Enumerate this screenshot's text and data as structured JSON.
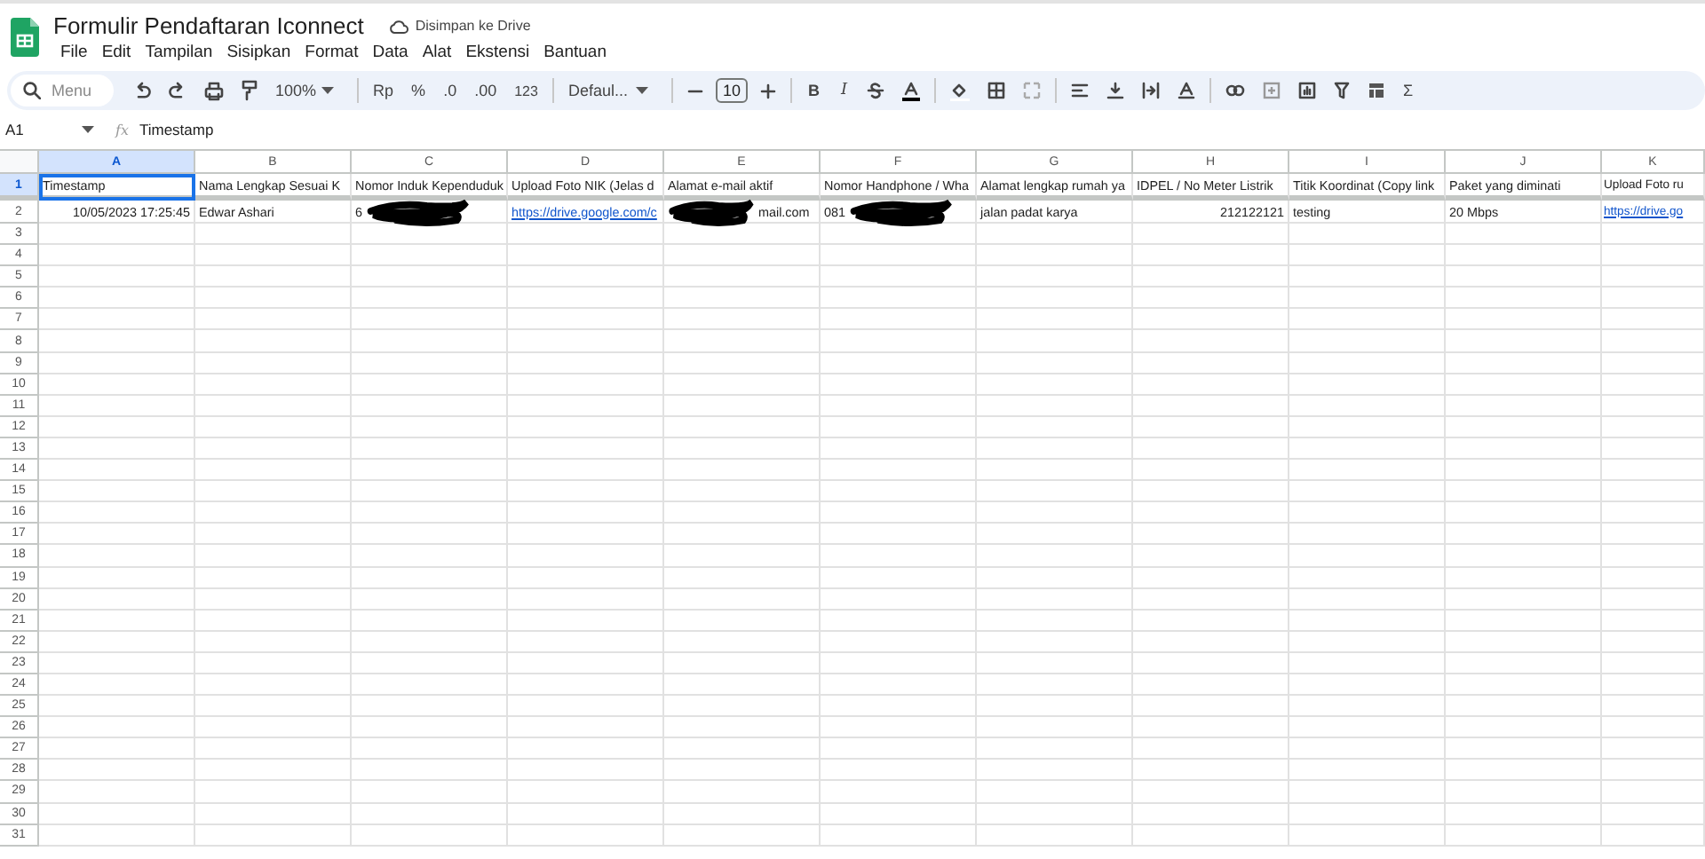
{
  "document": {
    "title": "Formulir Pendaftaran Iconnect",
    "save_status": "Disimpan ke Drive"
  },
  "menu": [
    "File",
    "Edit",
    "Tampilan",
    "Sisipkan",
    "Format",
    "Data",
    "Alat",
    "Ekstensi",
    "Bantuan"
  ],
  "toolbar": {
    "search_placeholder": "Menu",
    "zoom": "100%",
    "currency": "Rp",
    "percent": "%",
    "decrease_decimal": ".0",
    "increase_decimal": ".00",
    "number_format": "123",
    "font": "Defaul...",
    "font_size": "10",
    "bold": "B",
    "italic": "I",
    "functions": "Σ"
  },
  "formula_bar": {
    "name_box": "A1",
    "fx": "fx",
    "value": "Timestamp"
  },
  "columns": [
    {
      "label": "A",
      "selected": true
    },
    {
      "label": "B",
      "selected": false
    },
    {
      "label": "C",
      "selected": false
    },
    {
      "label": "D",
      "selected": false
    },
    {
      "label": "E",
      "selected": false
    },
    {
      "label": "F",
      "selected": false
    },
    {
      "label": "G",
      "selected": false
    },
    {
      "label": "H",
      "selected": false
    },
    {
      "label": "I",
      "selected": false
    },
    {
      "label": "J",
      "selected": false
    },
    {
      "label": "K",
      "selected": false
    }
  ],
  "rows": [
    {
      "number": "1",
      "selected": true,
      "cells": [
        {
          "kind": "text",
          "text": "Timestamp"
        },
        {
          "kind": "text",
          "text": "Nama Lengkap Sesuai K"
        },
        {
          "kind": "text",
          "text": "Nomor Induk Kependuduk"
        },
        {
          "kind": "text",
          "text": "Upload Foto NIK (Jelas d"
        },
        {
          "kind": "text",
          "text": "Alamat e-mail aktif"
        },
        {
          "kind": "text",
          "text": "Nomor Handphone / Wha"
        },
        {
          "kind": "text",
          "text": "Alamat lengkap rumah ya"
        },
        {
          "kind": "text",
          "text": "IDPEL / No Meter Listrik"
        },
        {
          "kind": "text",
          "text": "Titik Koordinat (Copy link"
        },
        {
          "kind": "text",
          "text": "Paket yang diminati"
        },
        {
          "kind": "text",
          "text": "Upload Foto ru"
        }
      ]
    },
    {
      "number": "2",
      "selected": false,
      "cells": [
        {
          "kind": "number",
          "text": "10/05/2023 17:25:45"
        },
        {
          "kind": "text",
          "text": "Edwar Ashari"
        },
        {
          "kind": "text",
          "text": "6",
          "redacted_after": true
        },
        {
          "kind": "link",
          "text": "https://drive.google.com/c"
        },
        {
          "kind": "text",
          "text": "mail.com",
          "redacted_before": true
        },
        {
          "kind": "text",
          "text": "081",
          "redacted_after": true
        },
        {
          "kind": "text",
          "text": "jalan padat karya"
        },
        {
          "kind": "number",
          "text": "212122121"
        },
        {
          "kind": "text",
          "text": "testing"
        },
        {
          "kind": "text",
          "text": "20 Mbps"
        },
        {
          "kind": "link",
          "text": "https://drive.go"
        }
      ]
    },
    {
      "number": "3",
      "selected": false
    },
    {
      "number": "4",
      "selected": false
    },
    {
      "number": "5",
      "selected": false
    },
    {
      "number": "6",
      "selected": false
    },
    {
      "number": "7",
      "selected": false
    },
    {
      "number": "8",
      "selected": false
    },
    {
      "number": "9",
      "selected": false
    },
    {
      "number": "10",
      "selected": false
    },
    {
      "number": "11",
      "selected": false
    },
    {
      "number": "12",
      "selected": false
    },
    {
      "number": "13",
      "selected": false
    },
    {
      "number": "14",
      "selected": false
    },
    {
      "number": "15",
      "selected": false
    },
    {
      "number": "16",
      "selected": false
    },
    {
      "number": "17",
      "selected": false
    },
    {
      "number": "18",
      "selected": false
    },
    {
      "number": "19",
      "selected": false
    },
    {
      "number": "20",
      "selected": false
    },
    {
      "number": "21",
      "selected": false
    },
    {
      "number": "22",
      "selected": false
    },
    {
      "number": "23",
      "selected": false
    },
    {
      "number": "24",
      "selected": false
    },
    {
      "number": "25",
      "selected": false
    },
    {
      "number": "26",
      "selected": false
    },
    {
      "number": "27",
      "selected": false
    },
    {
      "number": "28",
      "selected": false
    },
    {
      "number": "29",
      "selected": false
    },
    {
      "number": "30",
      "selected": false
    },
    {
      "number": "31",
      "selected": false
    }
  ]
}
